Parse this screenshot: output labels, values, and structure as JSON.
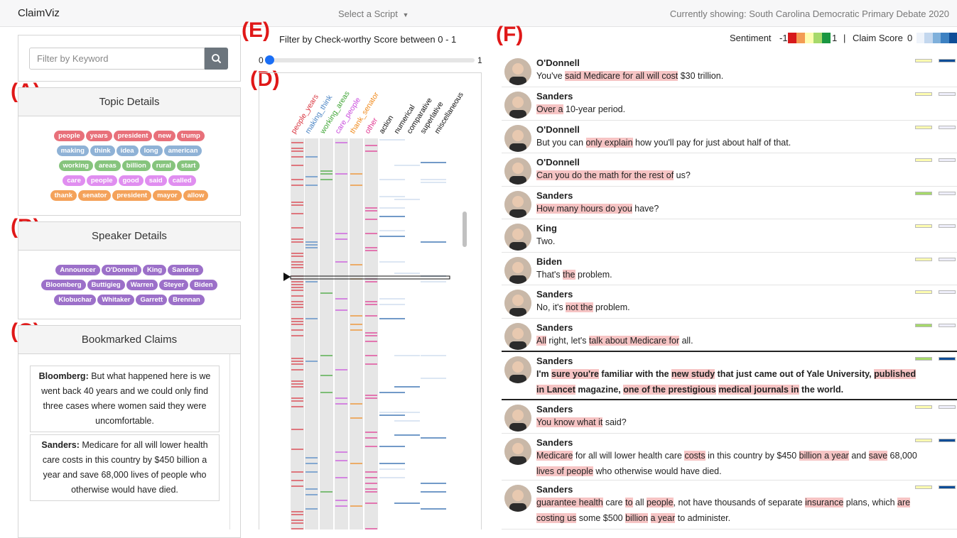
{
  "navbar": {
    "brand": "ClaimViz",
    "script_select": "Select a Script",
    "current": "Currently showing: South Carolina Democratic Primary Debate 2020"
  },
  "panel_labels": {
    "a": "(A)",
    "b": "(B)",
    "c": "(C)",
    "d": "(D)",
    "e": "(E)",
    "f": "(F)"
  },
  "search": {
    "placeholder": "Filter by Keyword"
  },
  "topics": {
    "title": "Topic Details",
    "rows": [
      {
        "color": "#e8707a",
        "words": [
          "people",
          "years",
          "president",
          "new",
          "trump"
        ]
      },
      {
        "color": "#8fb2d6",
        "words": [
          "making",
          "think",
          "idea",
          "long",
          "american"
        ]
      },
      {
        "color": "#86c47d",
        "words": [
          "working",
          "areas",
          "billion",
          "rural",
          "start"
        ]
      },
      {
        "color": "#e08ef0",
        "words": [
          "care",
          "people",
          "good",
          "said",
          "called"
        ]
      },
      {
        "color": "#f4a25a",
        "words": [
          "thank",
          "senator",
          "president",
          "mayor",
          "allow"
        ]
      }
    ]
  },
  "speakers": {
    "title": "Speaker Details",
    "color": "#9c70c9",
    "rows": [
      [
        "Announcer",
        "O'Donnell",
        "King",
        "Sanders"
      ],
      [
        "Bloomberg",
        "Buttigieg",
        "Warren",
        "Steyer",
        "Biden"
      ],
      [
        "Klobuchar",
        "Whitaker",
        "Garrett",
        "Brennan"
      ]
    ]
  },
  "bookmarks": {
    "title": "Bookmarked Claims",
    "items": [
      {
        "speaker": "Bloomberg:",
        "text": " But what happened here is we went back 40 years and we could only find three cases where women said they were uncomfortable."
      },
      {
        "speaker": "Sanders:",
        "text": " Medicare for all will lower health care costs in this country by $450 billion a year and save 68,000 lives of people who otherwise would have died."
      }
    ]
  },
  "filter": {
    "title": "Filter by Check-worthy Score between 0 - 1",
    "min": "0",
    "max": "1",
    "value": 0
  },
  "matrix": {
    "columns": [
      {
        "label": "people_years",
        "color": "#d9343f"
      },
      {
        "label": "making_think",
        "color": "#4a84c4"
      },
      {
        "label": "working_areas",
        "color": "#3fa535"
      },
      {
        "label": "care_people",
        "color": "#c94bdc"
      },
      {
        "label": "thank_senator",
        "color": "#f08a1c"
      },
      {
        "label": "other",
        "color": "#e0338f"
      },
      {
        "label": "action",
        "color": "#111111"
      },
      {
        "label": "numerical",
        "color": "#111111"
      },
      {
        "label": "comparative",
        "color": "#111111"
      },
      {
        "label": "superlative",
        "color": "#111111"
      },
      {
        "label": "miscellaneous",
        "color": "#111111"
      }
    ]
  },
  "legend": {
    "sentiment_label": "Sentiment",
    "sentiment_min": "-1",
    "sentiment_max": "1",
    "sentiment_colors": [
      "#d7191c",
      "#f39c53",
      "#fefdb0",
      "#a6d96a",
      "#1a9641"
    ],
    "separator": "|",
    "claim_label": "Claim Score",
    "claim_min": "0",
    "claim_colors": [
      "#eef3fa",
      "#c3d7ee",
      "#7fb0db",
      "#3d81c2",
      "#0e4d97"
    ]
  },
  "utterances": [
    {
      "speaker": "O'Donnell",
      "segments": [
        [
          "You've ",
          0
        ],
        [
          "said Medicare for all will cost",
          1
        ],
        [
          " $30 trillion.",
          0
        ]
      ],
      "sentiment": "#fefdb0",
      "claim": "#0e4d97"
    },
    {
      "speaker": "Sanders",
      "segments": [
        [
          "Over a",
          1
        ],
        [
          " 10-year period.",
          0
        ]
      ],
      "sentiment": "#fefdb0",
      "claim": "#eeeefa"
    },
    {
      "speaker": "O'Donnell",
      "segments": [
        [
          "But you can ",
          0
        ],
        [
          "only explain",
          1
        ],
        [
          " how you'll pay for just about half of that.",
          0
        ]
      ],
      "sentiment": "#fefdb0",
      "claim": "#eeeefa"
    },
    {
      "speaker": "O'Donnell",
      "segments": [
        [
          "Can you do the math for the rest of",
          1
        ],
        [
          " us?",
          0
        ]
      ],
      "sentiment": "#fefdb0",
      "claim": "#eeeefa"
    },
    {
      "speaker": "Sanders",
      "segments": [
        [
          "How many hours do you",
          1
        ],
        [
          " have?",
          0
        ]
      ],
      "sentiment": "#a6d96a",
      "claim": "#eeeefa"
    },
    {
      "speaker": "King",
      "segments": [
        [
          "Two.",
          0
        ]
      ],
      "sentiment": "#fefdb0",
      "claim": "#eeeefa"
    },
    {
      "speaker": "Biden",
      "segments": [
        [
          "That's ",
          0
        ],
        [
          "the",
          1
        ],
        [
          " problem.",
          0
        ]
      ],
      "sentiment": "#fefdb0",
      "claim": "#eeeefa"
    },
    {
      "speaker": "Sanders",
      "segments": [
        [
          "No, it's ",
          0
        ],
        [
          "not the",
          1
        ],
        [
          " problem.",
          0
        ]
      ],
      "sentiment": "#fefdb0",
      "claim": "#eeeefa"
    },
    {
      "speaker": "Sanders",
      "segments": [
        [
          "All",
          1
        ],
        [
          " right, let's ",
          0
        ],
        [
          "talk about Medicare for",
          1
        ],
        [
          " all.",
          0
        ]
      ],
      "sentiment": "#a6d96a",
      "claim": "#eeeefa"
    },
    {
      "speaker": "Sanders",
      "big": true,
      "segments": [
        [
          "I'm ",
          0
        ],
        [
          "sure you're",
          1
        ],
        [
          " familiar with the ",
          0
        ],
        [
          "new study",
          1
        ],
        [
          " that just came out of Yale University, ",
          0
        ],
        [
          "published in Lancet",
          1
        ],
        [
          " magazine, ",
          0
        ],
        [
          "one of the prestigious",
          1
        ],
        [
          " ",
          0
        ],
        [
          "medical journals in",
          1
        ],
        [
          " the world.",
          0
        ]
      ],
      "sentiment": "#a6d96a",
      "claim": "#0e4d97"
    },
    {
      "speaker": "Sanders",
      "segments": [
        [
          "You know what it",
          1
        ],
        [
          " said?",
          0
        ]
      ],
      "sentiment": "#fefdb0",
      "claim": "#eeeefa"
    },
    {
      "speaker": "Sanders",
      "segments": [
        [
          "Medicare",
          1
        ],
        [
          " for all will lower health care ",
          0
        ],
        [
          "costs",
          1
        ],
        [
          " in this country by $450 ",
          0
        ],
        [
          "billion a year",
          1
        ],
        [
          " and ",
          0
        ],
        [
          "save",
          1
        ],
        [
          " 68,000 ",
          0
        ],
        [
          "lives of people",
          1
        ],
        [
          " who otherwise would have died.",
          0
        ]
      ],
      "sentiment": "#fefdb0",
      "claim": "#0e4d97"
    },
    {
      "speaker": "Sanders",
      "segments": [
        [
          "guarantee health",
          1
        ],
        [
          " care ",
          0
        ],
        [
          "to",
          1
        ],
        [
          " all ",
          0
        ],
        [
          "people",
          1
        ],
        [
          ", not have thousands of separate ",
          0
        ],
        [
          "insurance",
          1
        ],
        [
          " plans, which ",
          0
        ],
        [
          "are costing us",
          1
        ],
        [
          " some $500 ",
          0
        ],
        [
          "billion",
          1
        ],
        [
          " ",
          0
        ],
        [
          "a year",
          1
        ],
        [
          " to administer.",
          0
        ]
      ],
      "sentiment": "#fefdb0",
      "claim": "#0e4d97"
    }
  ]
}
